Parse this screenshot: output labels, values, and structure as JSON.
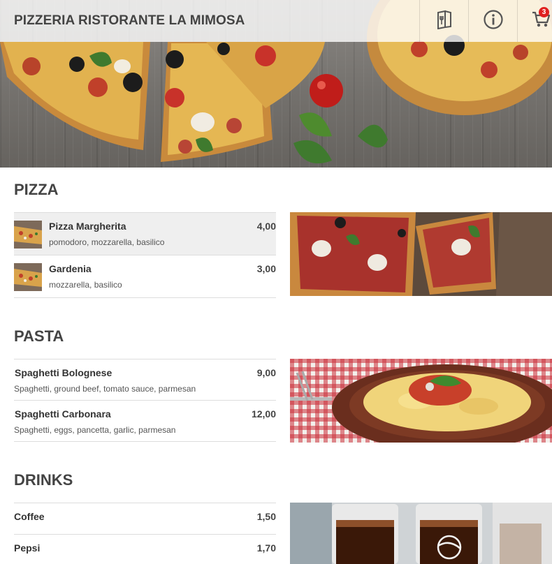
{
  "header": {
    "title": "PIZZERIA RISTORANTE LA MIMOSA",
    "cart_count": "3",
    "icons": [
      "menu-book-icon",
      "info-icon",
      "cart-icon"
    ]
  },
  "colors": {
    "badge": "#e02020",
    "text": "#333333",
    "title": "#444444",
    "divider": "#dddddd",
    "highlight_row": "#efefef"
  },
  "sections": [
    {
      "title": "PIZZA",
      "items": [
        {
          "name": "Pizza Margherita",
          "description": "pomodoro, mozzarella, basilico",
          "price": "4,00"
        },
        {
          "name": "Gardenia",
          "description": "mozzarella, basilico",
          "price": "3,00"
        }
      ]
    },
    {
      "title": "PASTA",
      "items": [
        {
          "name": "Spaghetti Bolognese",
          "description": "Spaghetti, ground beef, tomato sauce, parmesan",
          "price": "9,00"
        },
        {
          "name": "Spaghetti Carbonara",
          "description": "Spaghetti, eggs, pancetta, garlic, parmesan",
          "price": "12,00"
        }
      ]
    },
    {
      "title": "DRINKS",
      "items": [
        {
          "name": "Coffee",
          "price": "1,50"
        },
        {
          "name": "Pepsi",
          "price": "1,70"
        }
      ]
    }
  ]
}
